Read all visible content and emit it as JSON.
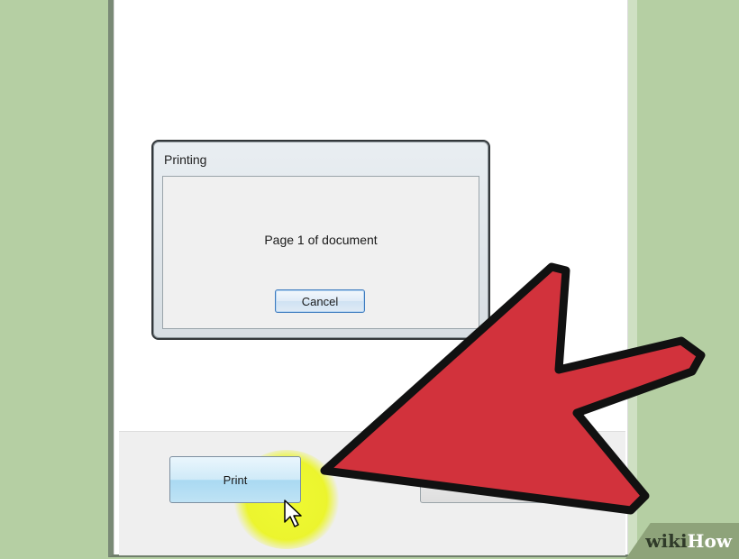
{
  "dialog": {
    "title": "Printing",
    "message": "Page 1 of document",
    "cancel_label": "Cancel"
  },
  "footer": {
    "print_label": "Print",
    "second_button_label": ""
  },
  "watermark": {
    "logo_text": "wikiHow"
  },
  "annotation": {
    "arrow_color": "#d2323c",
    "highlight_color": "#f0f71e"
  }
}
